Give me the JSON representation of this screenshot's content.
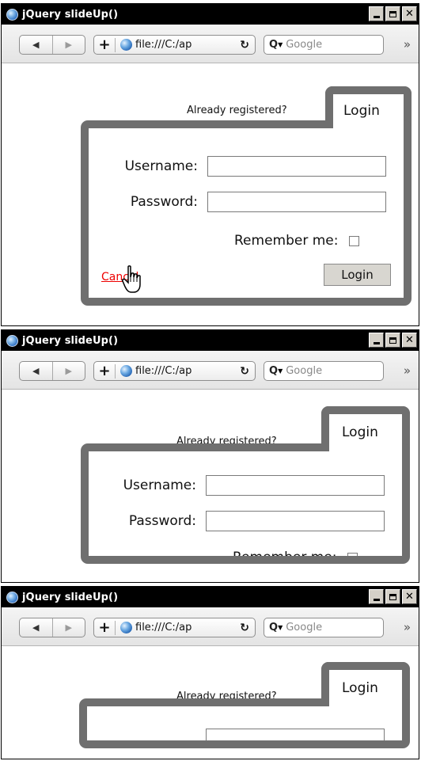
{
  "window": {
    "title": "jQuery slideUp()",
    "controls": {
      "minimize": "minimize",
      "maximize": "maximize",
      "close": "✕"
    }
  },
  "toolbar": {
    "back": "◀",
    "forward": "▶",
    "add": "+",
    "address": "file:///C:/ap",
    "reload": "↻",
    "search_placeholder": "Google",
    "search_icon": "Q",
    "overflow": "»"
  },
  "login": {
    "already_registered": "Already registered?",
    "tab_label": "Login",
    "username_label": "Username:",
    "password_label": "Password:",
    "remember_label": "Remember me:",
    "cancel_label": "Cancel",
    "submit_label": "Login"
  }
}
